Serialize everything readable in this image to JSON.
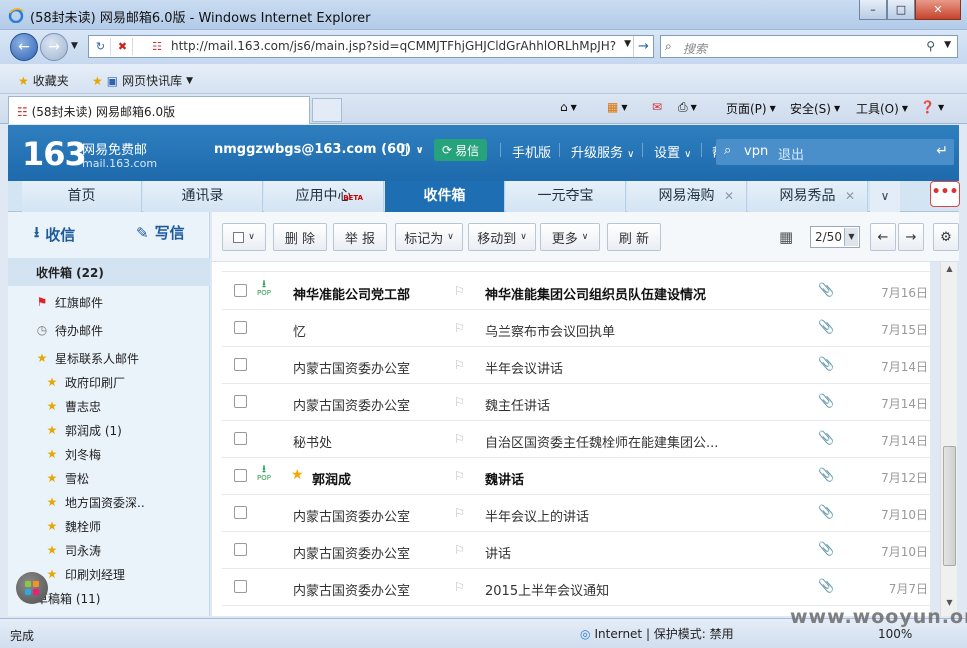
{
  "window": {
    "title": "(58封未读) 网易邮箱6.0版 - Windows Internet Explorer"
  },
  "browser": {
    "url": "http://mail.163.com/js6/main.jsp?sid=qCMMJTFhjGHJCldGrAhhlORLhMpJH?",
    "search_placeholder": "搜索",
    "favorites_label": "收藏夹",
    "quick_link": "网页快讯库",
    "tab_title": "(58封未读) 网易邮箱6.0版",
    "commands": {
      "page": "页面(P)",
      "safety": "安全(S)",
      "tools": "工具(O)"
    }
  },
  "mail": {
    "logo_number": "163",
    "logo_title": "网易免费邮",
    "logo_domain": "mail.163.com",
    "user": "nmggzwbgs@163.com",
    "user_count": "(60)",
    "yixin": "易信",
    "mobile": "手机版",
    "upgrade": "升级服务",
    "settings": "设置",
    "help": "帮助",
    "search_value": "vpn",
    "logout": "退出",
    "tabs": [
      {
        "label": "首页"
      },
      {
        "label": "通讯录"
      },
      {
        "label": "应用中心",
        "badge": "BETA"
      },
      {
        "label": "收件箱"
      },
      {
        "label": "一元夺宝"
      },
      {
        "label": "网易海购"
      },
      {
        "label": "网易秀品"
      }
    ],
    "sidebar": {
      "receive": "收信",
      "compose": "写信",
      "inbox": "收件箱 (22)",
      "red_flag": "红旗邮件",
      "pending": "待办邮件",
      "star_contacts": "星标联系人邮件",
      "contacts": [
        "政府印刷厂",
        "曹志忠",
        "郭润成 (1)",
        "刘冬梅",
        "雪松",
        "地方国资委深..",
        "魏栓师",
        "司永涛",
        "印刷刘经理"
      ],
      "drafts": "草稿箱 (11)"
    },
    "toolbar": {
      "delete": "删 除",
      "report": "举 报",
      "mark_as": "标记为",
      "move_to": "移动到",
      "more": "更多",
      "refresh": "刷 新",
      "page": "2/50"
    },
    "messages": [
      {
        "from": "神华准能公司党工部",
        "subject": "神华准能集团公司组织员队伍建设情况",
        "date": "7月16日",
        "bold": true,
        "pop": true,
        "star": false
      },
      {
        "from": "忆",
        "subject": "乌兰察布市会议回执单",
        "date": "7月15日",
        "bold": false,
        "pop": false,
        "star": false
      },
      {
        "from": "内蒙古国资委办公室",
        "subject": "半年会议讲话",
        "date": "7月14日",
        "bold": false,
        "pop": false,
        "star": false
      },
      {
        "from": "内蒙古国资委办公室",
        "subject": "魏主任讲话",
        "date": "7月14日",
        "bold": false,
        "pop": false,
        "star": false
      },
      {
        "from": "秘书处",
        "subject": "自治区国资委主任魏栓师在能建集团公...",
        "date": "7月14日",
        "bold": false,
        "pop": false,
        "star": false
      },
      {
        "from": "郭润成",
        "subject": "魏讲话",
        "date": "7月12日",
        "bold": true,
        "pop": true,
        "star": true
      },
      {
        "from": "内蒙古国资委办公室",
        "subject": "半年会议上的讲话",
        "date": "7月10日",
        "bold": false,
        "pop": false,
        "star": false
      },
      {
        "from": "内蒙古国资委办公室",
        "subject": "讲话",
        "date": "7月10日",
        "bold": false,
        "pop": false,
        "star": false
      },
      {
        "from": "内蒙古国资委办公室",
        "subject": "2015上半年会议通知",
        "date": "7月7日",
        "bold": false,
        "pop": false,
        "star": false
      }
    ]
  },
  "status": {
    "done": "完成",
    "zone": "Internet | 保护模式: 禁用",
    "zoom": "100%",
    "watermark": "www.wooyun.org"
  }
}
